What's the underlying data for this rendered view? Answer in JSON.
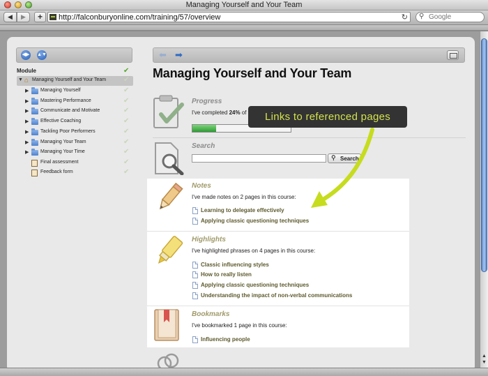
{
  "window": {
    "title": "Managing Yourself and Your Team"
  },
  "toolbar": {
    "back_icon": "◀",
    "forward_icon": "▶",
    "plus_label": "+",
    "url": "http://falconburyonline.com/training/57/overview",
    "reload_icon": "↻",
    "search_placeholder": "Google"
  },
  "sidebar": {
    "heading": "Module",
    "root_label": "Managing Yourself and Your Team",
    "items": [
      {
        "label": "Managing Yourself"
      },
      {
        "label": "Mastering Performance"
      },
      {
        "label": "Communicate and Motivate"
      },
      {
        "label": "Effective Coaching"
      },
      {
        "label": "Tackling Poor Performers"
      },
      {
        "label": "Managing Your Team"
      },
      {
        "label": "Managing Your Time"
      }
    ],
    "extras": [
      {
        "label": "Final assessment"
      },
      {
        "label": "Feedback form"
      }
    ]
  },
  "main": {
    "title": "Managing Yourself and Your Team",
    "progress": {
      "heading": "Progress",
      "text_prefix": "I've completed",
      "percent_text": "24%",
      "text_suffix": "of this course.",
      "percent": 24
    },
    "search": {
      "heading": "Search",
      "button_label": "Search"
    },
    "notes": {
      "heading": "Notes",
      "summary": "I've made notes on 2 pages in this course:",
      "links": [
        "Learning to delegate effectively",
        "Applying classic questioning techniques"
      ]
    },
    "highlights": {
      "heading": "Highlights",
      "summary": "I've highlighted phrases on 4 pages in this course:",
      "links": [
        "Classic influencing styles",
        "How to really listen",
        "Applying classic questioning techniques",
        "Understanding the impact of non-verbal communications"
      ]
    },
    "bookmarks": {
      "heading": "Bookmarks",
      "summary": "I've bookmarked 1 page in this course:",
      "links": [
        "Influencing people"
      ]
    }
  },
  "callout": {
    "text": "Links to referenced pages"
  },
  "colors": {
    "accent_green": "#c6dc1e",
    "link_color": "#5d5a2e",
    "progress_green": "#2f9a35"
  }
}
